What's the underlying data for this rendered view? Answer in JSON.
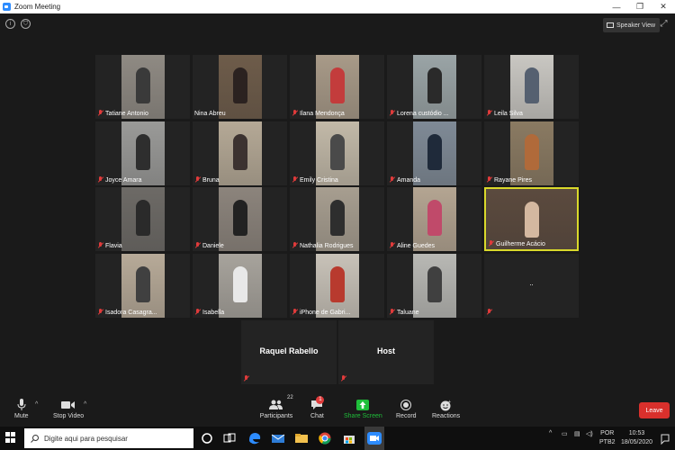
{
  "window": {
    "title": "Zoom Meeting",
    "minimize": "—",
    "restore": "❐",
    "close": "✕"
  },
  "top": {
    "speaker_view": "Speaker View",
    "fullscreen": "⤢",
    "info_glyph": "i",
    "shield_glyph": "⛉"
  },
  "participants_grid": [
    {
      "name": "Tatiane Antonio",
      "muted": true,
      "bg": "#8f8a83",
      "figure": "#3a3a3a"
    },
    {
      "name": "Nina Abreu",
      "muted": false,
      "bg": "#6e5c4a",
      "figure": "#2b2220"
    },
    {
      "name": "Ilana Mendonça",
      "muted": true,
      "bg": "#a89a88",
      "figure": "#c33c3c"
    },
    {
      "name": "Lorena custódio ...",
      "muted": true,
      "bg": "#9aa4a6",
      "figure": "#2a2a2a"
    },
    {
      "name": "Leila Silva",
      "muted": true,
      "bg": "#c9c7c2",
      "figure": "#556070"
    },
    {
      "name": "Joyce Amara",
      "muted": true,
      "bg": "#9a9a98",
      "figure": "#2e2e2e"
    },
    {
      "name": "Bruna",
      "muted": true,
      "bg": "#b5a996",
      "figure": "#3c3230"
    },
    {
      "name": "Emily Cristina",
      "muted": true,
      "bg": "#c2b9a8",
      "figure": "#4a4a4a"
    },
    {
      "name": "Amanda",
      "muted": true,
      "bg": "#7f8a96",
      "figure": "#1f2a3a"
    },
    {
      "name": "Rayane Pires",
      "muted": true,
      "bg": "#8a7a62",
      "figure": "#b06a3a"
    },
    {
      "name": "Flavia",
      "muted": true,
      "bg": "#6d6a66",
      "figure": "#2a2a2a"
    },
    {
      "name": "Daniele",
      "muted": true,
      "bg": "#8c847c",
      "figure": "#222222"
    },
    {
      "name": "Nathalia Rodrigues",
      "muted": true,
      "bg": "#a79e90",
      "figure": "#2e2e2e"
    },
    {
      "name": "Aline Guedes",
      "muted": true,
      "bg": "#b4a592",
      "figure": "#c04a6a"
    },
    {
      "name": "Guilherme Acácio",
      "muted": true,
      "bg": "#5b4a3e",
      "figure": "#d4b8a0",
      "active": true
    },
    {
      "name": "Isadora Casagra...",
      "muted": true,
      "bg": "#b7aa98",
      "figure": "#404040"
    },
    {
      "name": "Isabella",
      "muted": true,
      "bg": "#a7a39c",
      "figure": "#e8e8e8"
    },
    {
      "name": "iPhone de Gabri...",
      "muted": true,
      "bg": "#c8c2b8",
      "figure": "#b83a2e"
    },
    {
      "name": "Taluane",
      "muted": true,
      "bg": "#b8b8b4",
      "figure": "#404040"
    },
    {
      "name": "",
      "muted": true,
      "bg": "#232323",
      "figure": "",
      "center_text": ".."
    }
  ],
  "bottom_tiles": [
    {
      "name": "Raquel Rabello",
      "muted": true
    },
    {
      "name": "Host",
      "muted": true
    }
  ],
  "toolbar": {
    "mute": "Mute",
    "stop_video": "Stop Video",
    "participants": "Participants",
    "participants_count": "22",
    "chat": "Chat",
    "chat_badge": "1",
    "share_screen": "Share Screen",
    "record": "Record",
    "reactions": "Reactions",
    "leave": "Leave",
    "caret": "^"
  },
  "taskbar": {
    "search_placeholder": "Digite aqui para pesquisar",
    "lang_top": "POR",
    "lang_bottom": "PTB2",
    "time": "10:53",
    "date": "18/05/2020",
    "tray_caret": "^"
  },
  "colors": {
    "share_green": "#1fbf3a",
    "leave_red": "#d9302c",
    "mute_red": "#e03b3b",
    "active_border": "#d9d92b"
  }
}
